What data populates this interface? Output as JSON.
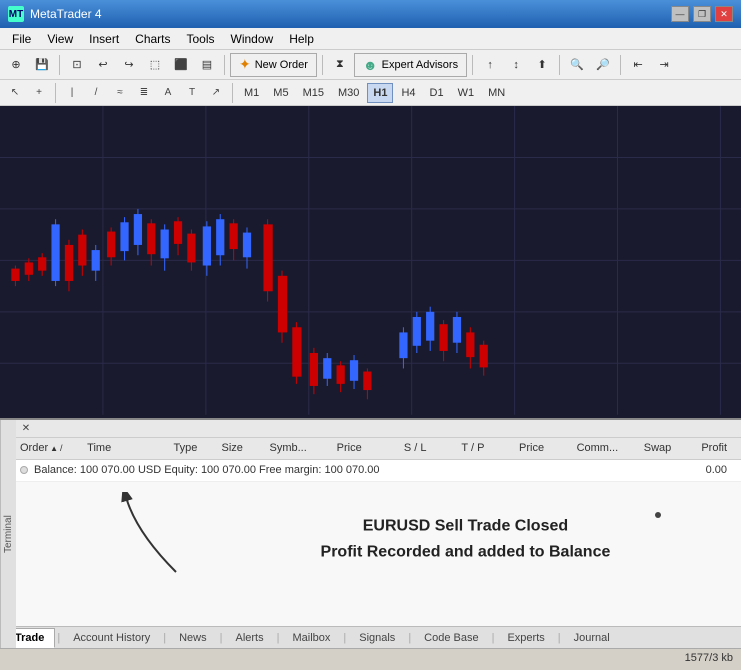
{
  "title": {
    "app_name": "MetaTrader 4",
    "icon_text": "MT",
    "controls": {
      "minimize": "—",
      "restore": "❐",
      "close": "✕"
    }
  },
  "menu": {
    "items": [
      "File",
      "View",
      "Insert",
      "Charts",
      "Tools",
      "Window",
      "Help"
    ]
  },
  "toolbar1": {
    "new_order_label": "New Order",
    "expert_advisors_label": "Expert Advisors",
    "buttons": [
      "⊕",
      "💾",
      "⊡",
      "↩",
      "↪",
      "⬚",
      "⬛",
      "▤",
      "⬡"
    ]
  },
  "toolbar2": {
    "timeframes": [
      "M1",
      "M5",
      "M15",
      "M30",
      "H1",
      "H4",
      "D1",
      "W1",
      "MN"
    ],
    "active_timeframe": "H1",
    "tools": [
      "↖",
      "+",
      "|",
      "\\",
      "≈",
      "≣",
      "A",
      "T",
      "≈"
    ]
  },
  "chart": {
    "background": "#1a1a2e"
  },
  "terminal": {
    "label": "Terminal",
    "table_headers": {
      "order": "Order",
      "time": "Time",
      "type": "Type",
      "size": "Size",
      "symbol": "Symb...",
      "price": "Price",
      "sl": "S / L",
      "tp": "T / P",
      "price2": "Price",
      "comm": "Comm...",
      "swap": "Swap",
      "profit": "Profit"
    },
    "balance_row": {
      "text": "Balance: 100 070.00 USD   Equity: 100 070.00   Free margin: 100 070.00",
      "profit_value": "0.00"
    }
  },
  "annotation": {
    "line1": "EURUSD Sell Trade Closed",
    "line2": "Profit Recorded and added to Balance"
  },
  "tabs": {
    "items": [
      "Trade",
      "Account History",
      "News",
      "Alerts",
      "Mailbox",
      "Signals",
      "Code Base",
      "Experts",
      "Journal"
    ],
    "active": "Trade"
  },
  "status_bar": {
    "text": "1577/3 kb"
  },
  "colors": {
    "bullish": "#3366ff",
    "bearish": "#cc0000",
    "chart_bg": "#1a1a2e",
    "grid": "#2a2a4a"
  }
}
